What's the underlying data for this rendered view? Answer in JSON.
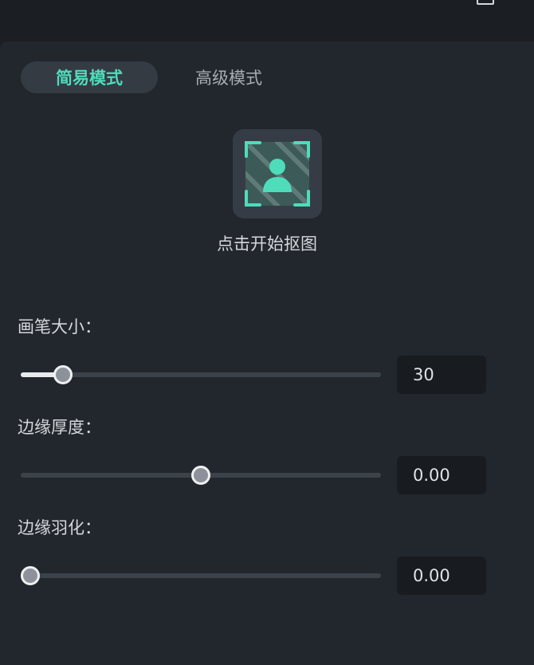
{
  "tabs": [
    {
      "label": "简易模式",
      "active": true
    },
    {
      "label": "高级模式",
      "active": false
    }
  ],
  "cutout": {
    "icon": "person-frame-icon",
    "label": "点击开始抠图",
    "accent": "#4fdcbb"
  },
  "sliders": [
    {
      "label": "画笔大小：",
      "value": "30",
      "position": 0.11
    },
    {
      "label": "边缘厚度：",
      "value": "0.00",
      "position": 0.5
    },
    {
      "label": "边缘羽化：",
      "value": "0.00",
      "position": 0.0
    }
  ]
}
